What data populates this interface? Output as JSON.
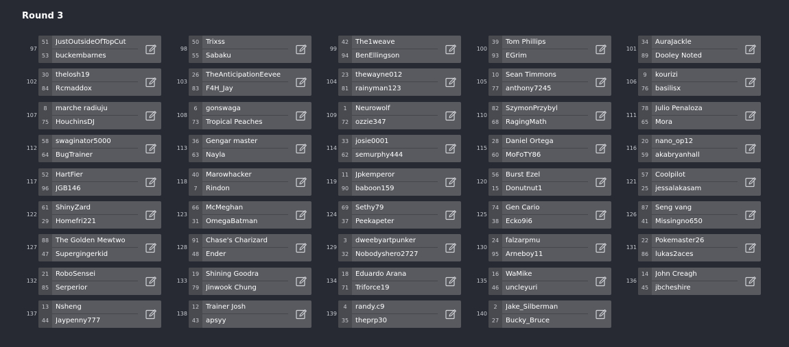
{
  "round_title": "Round 3",
  "icons": {
    "edit": "edit-pencil-icon"
  },
  "colors": {
    "background": "#272a33",
    "card": "#585a60",
    "seed_cell": "#484a50",
    "text": "#ffffff"
  },
  "matches": [
    {
      "num": "97",
      "p1": {
        "seed": "51",
        "name": "JustOutsideOfTopCut"
      },
      "p2": {
        "seed": "53",
        "name": "buckembarnes"
      }
    },
    {
      "num": "98",
      "p1": {
        "seed": "50",
        "name": "Trixss"
      },
      "p2": {
        "seed": "55",
        "name": "Sabaku"
      }
    },
    {
      "num": "99",
      "p1": {
        "seed": "42",
        "name": "The1weave"
      },
      "p2": {
        "seed": "94",
        "name": "BenEllingson"
      }
    },
    {
      "num": "100",
      "p1": {
        "seed": "39",
        "name": "Tom Phillips"
      },
      "p2": {
        "seed": "93",
        "name": "EGrim"
      }
    },
    {
      "num": "101",
      "p1": {
        "seed": "34",
        "name": "AuraJackle"
      },
      "p2": {
        "seed": "89",
        "name": "Dooley Noted"
      }
    },
    {
      "num": "102",
      "p1": {
        "seed": "30",
        "name": "thelosh19"
      },
      "p2": {
        "seed": "84",
        "name": "Rcmaddox"
      }
    },
    {
      "num": "103",
      "p1": {
        "seed": "26",
        "name": "TheAnticipationEevee"
      },
      "p2": {
        "seed": "83",
        "name": "F4H_Jay"
      }
    },
    {
      "num": "104",
      "p1": {
        "seed": "23",
        "name": "thewayne012"
      },
      "p2": {
        "seed": "81",
        "name": "rainyman123"
      }
    },
    {
      "num": "105",
      "p1": {
        "seed": "10",
        "name": "Sean Timmons"
      },
      "p2": {
        "seed": "77",
        "name": "anthony7245"
      }
    },
    {
      "num": "106",
      "p1": {
        "seed": "9",
        "name": "kourizi"
      },
      "p2": {
        "seed": "76",
        "name": "basilisx"
      }
    },
    {
      "num": "107",
      "p1": {
        "seed": "8",
        "name": "marche radiuju"
      },
      "p2": {
        "seed": "75",
        "name": "HouchinsDJ"
      }
    },
    {
      "num": "108",
      "p1": {
        "seed": "6",
        "name": "gonswaga"
      },
      "p2": {
        "seed": "73",
        "name": "Tropical Peaches"
      }
    },
    {
      "num": "109",
      "p1": {
        "seed": "1",
        "name": "Neurowolf"
      },
      "p2": {
        "seed": "72",
        "name": "ozzie347"
      }
    },
    {
      "num": "110",
      "p1": {
        "seed": "82",
        "name": "SzymonPrzybyl"
      },
      "p2": {
        "seed": "68",
        "name": "RagingMath"
      }
    },
    {
      "num": "111",
      "p1": {
        "seed": "78",
        "name": "Julio Penaloza"
      },
      "p2": {
        "seed": "65",
        "name": "Mora"
      }
    },
    {
      "num": "112",
      "p1": {
        "seed": "58",
        "name": "swaginator5000"
      },
      "p2": {
        "seed": "64",
        "name": "BugTrainer"
      }
    },
    {
      "num": "113",
      "p1": {
        "seed": "36",
        "name": "Gengar master"
      },
      "p2": {
        "seed": "63",
        "name": "Nayla"
      }
    },
    {
      "num": "114",
      "p1": {
        "seed": "33",
        "name": "josie0001"
      },
      "p2": {
        "seed": "62",
        "name": "semurphy444"
      }
    },
    {
      "num": "115",
      "p1": {
        "seed": "28",
        "name": "Daniel Ortega"
      },
      "p2": {
        "seed": "60",
        "name": "MoFoTY86"
      }
    },
    {
      "num": "116",
      "p1": {
        "seed": "20",
        "name": "nano_op12"
      },
      "p2": {
        "seed": "59",
        "name": "akabryanhall"
      }
    },
    {
      "num": "117",
      "p1": {
        "seed": "52",
        "name": "HartFier"
      },
      "p2": {
        "seed": "96",
        "name": "JGB146"
      }
    },
    {
      "num": "118",
      "p1": {
        "seed": "40",
        "name": "Marowhacker"
      },
      "p2": {
        "seed": "7",
        "name": "Rindon"
      }
    },
    {
      "num": "119",
      "p1": {
        "seed": "11",
        "name": "Jpkemperor"
      },
      "p2": {
        "seed": "90",
        "name": "baboon159"
      }
    },
    {
      "num": "120",
      "p1": {
        "seed": "56",
        "name": "Burst Ezel"
      },
      "p2": {
        "seed": "15",
        "name": "Donutnut1"
      }
    },
    {
      "num": "121",
      "p1": {
        "seed": "57",
        "name": "Coolpilot"
      },
      "p2": {
        "seed": "25",
        "name": "jessalakasam"
      }
    },
    {
      "num": "122",
      "p1": {
        "seed": "61",
        "name": "ShinyZard"
      },
      "p2": {
        "seed": "29",
        "name": "Homefri221"
      }
    },
    {
      "num": "123",
      "p1": {
        "seed": "66",
        "name": "McMeghan"
      },
      "p2": {
        "seed": "31",
        "name": "OmegaBatman"
      }
    },
    {
      "num": "124",
      "p1": {
        "seed": "69",
        "name": "Sethy79"
      },
      "p2": {
        "seed": "37",
        "name": "Peekapeter"
      }
    },
    {
      "num": "125",
      "p1": {
        "seed": "74",
        "name": "Gen Cario"
      },
      "p2": {
        "seed": "38",
        "name": "Ecko9i6"
      }
    },
    {
      "num": "126",
      "p1": {
        "seed": "87",
        "name": "Seng vang"
      },
      "p2": {
        "seed": "41",
        "name": "Missingno650"
      }
    },
    {
      "num": "127",
      "p1": {
        "seed": "88",
        "name": "The Golden Mewtwo"
      },
      "p2": {
        "seed": "47",
        "name": "Supergingerkid"
      }
    },
    {
      "num": "128",
      "p1": {
        "seed": "91",
        "name": "Chase's Charizard"
      },
      "p2": {
        "seed": "48",
        "name": "Ender"
      }
    },
    {
      "num": "129",
      "p1": {
        "seed": "3",
        "name": "dweebyartpunker"
      },
      "p2": {
        "seed": "32",
        "name": "Nobodyshero2727"
      }
    },
    {
      "num": "130",
      "p1": {
        "seed": "24",
        "name": "falzarpmu"
      },
      "p2": {
        "seed": "95",
        "name": "Arneboy11"
      }
    },
    {
      "num": "131",
      "p1": {
        "seed": "22",
        "name": "Pokemaster26"
      },
      "p2": {
        "seed": "86",
        "name": "lukas2aces"
      }
    },
    {
      "num": "132",
      "p1": {
        "seed": "21",
        "name": "RoboSensei"
      },
      "p2": {
        "seed": "85",
        "name": "Serperior"
      }
    },
    {
      "num": "133",
      "p1": {
        "seed": "19",
        "name": "Shining Goodra"
      },
      "p2": {
        "seed": "79",
        "name": "Jinwook Chung"
      }
    },
    {
      "num": "134",
      "p1": {
        "seed": "18",
        "name": "Eduardo Arana"
      },
      "p2": {
        "seed": "71",
        "name": "Triforce19"
      }
    },
    {
      "num": "135",
      "p1": {
        "seed": "16",
        "name": "WaMike"
      },
      "p2": {
        "seed": "46",
        "name": "uncleyuri"
      }
    },
    {
      "num": "136",
      "p1": {
        "seed": "14",
        "name": "John Creagh"
      },
      "p2": {
        "seed": "45",
        "name": "jbcheshire"
      }
    },
    {
      "num": "137",
      "p1": {
        "seed": "13",
        "name": "Nsheng"
      },
      "p2": {
        "seed": "44",
        "name": "Jaypenny777"
      }
    },
    {
      "num": "138",
      "p1": {
        "seed": "12",
        "name": "Trainer Josh"
      },
      "p2": {
        "seed": "43",
        "name": "apsyy"
      }
    },
    {
      "num": "139",
      "p1": {
        "seed": "4",
        "name": "randy.c9"
      },
      "p2": {
        "seed": "35",
        "name": "theprp30"
      }
    },
    {
      "num": "140",
      "p1": {
        "seed": "2",
        "name": "Jake_Silberman"
      },
      "p2": {
        "seed": "27",
        "name": "Bucky_Bruce"
      }
    }
  ]
}
